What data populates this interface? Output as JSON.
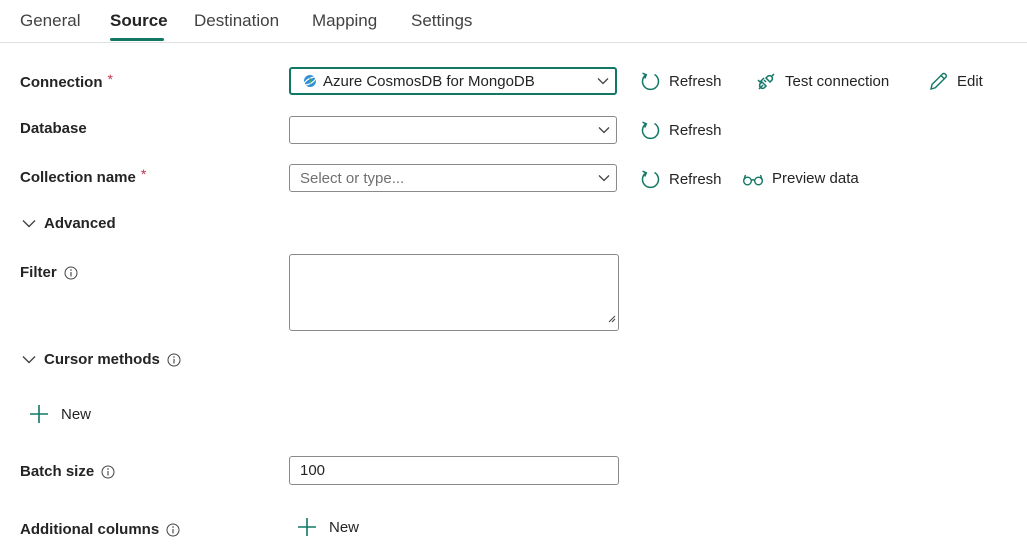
{
  "tabs": [
    {
      "label": "General"
    },
    {
      "label": "Source"
    },
    {
      "label": "Destination"
    },
    {
      "label": "Mapping"
    },
    {
      "label": "Settings"
    }
  ],
  "active_tab": "Source",
  "form": {
    "connection": {
      "label": "Connection",
      "required_mark": "*",
      "value": "Azure CosmosDB for MongoDB",
      "actions": {
        "refresh": "Refresh",
        "test": "Test connection",
        "edit": "Edit"
      }
    },
    "database": {
      "label": "Database",
      "value": "",
      "actions": {
        "refresh": "Refresh"
      }
    },
    "collection": {
      "label": "Collection name",
      "required_mark": "*",
      "placeholder": "Select or type...",
      "actions": {
        "refresh": "Refresh",
        "preview": "Preview data"
      }
    },
    "advanced": {
      "label": "Advanced"
    },
    "filter": {
      "label": "Filter",
      "value": ""
    },
    "cursor_methods": {
      "label": "Cursor methods",
      "new_label": "New"
    },
    "batch_size": {
      "label": "Batch size",
      "value": "100"
    },
    "additional_columns": {
      "label": "Additional columns",
      "new_label": "New"
    }
  },
  "colors": {
    "accent": "#117865",
    "required": "#c4314b"
  },
  "icons": {
    "refresh": "refresh-icon",
    "test": "plug-test-icon",
    "edit": "pencil-icon",
    "preview": "glasses-icon",
    "info": "info-icon",
    "chevron": "chevron-down-icon",
    "add": "plus-icon",
    "db": "cosmosdb-icon"
  }
}
